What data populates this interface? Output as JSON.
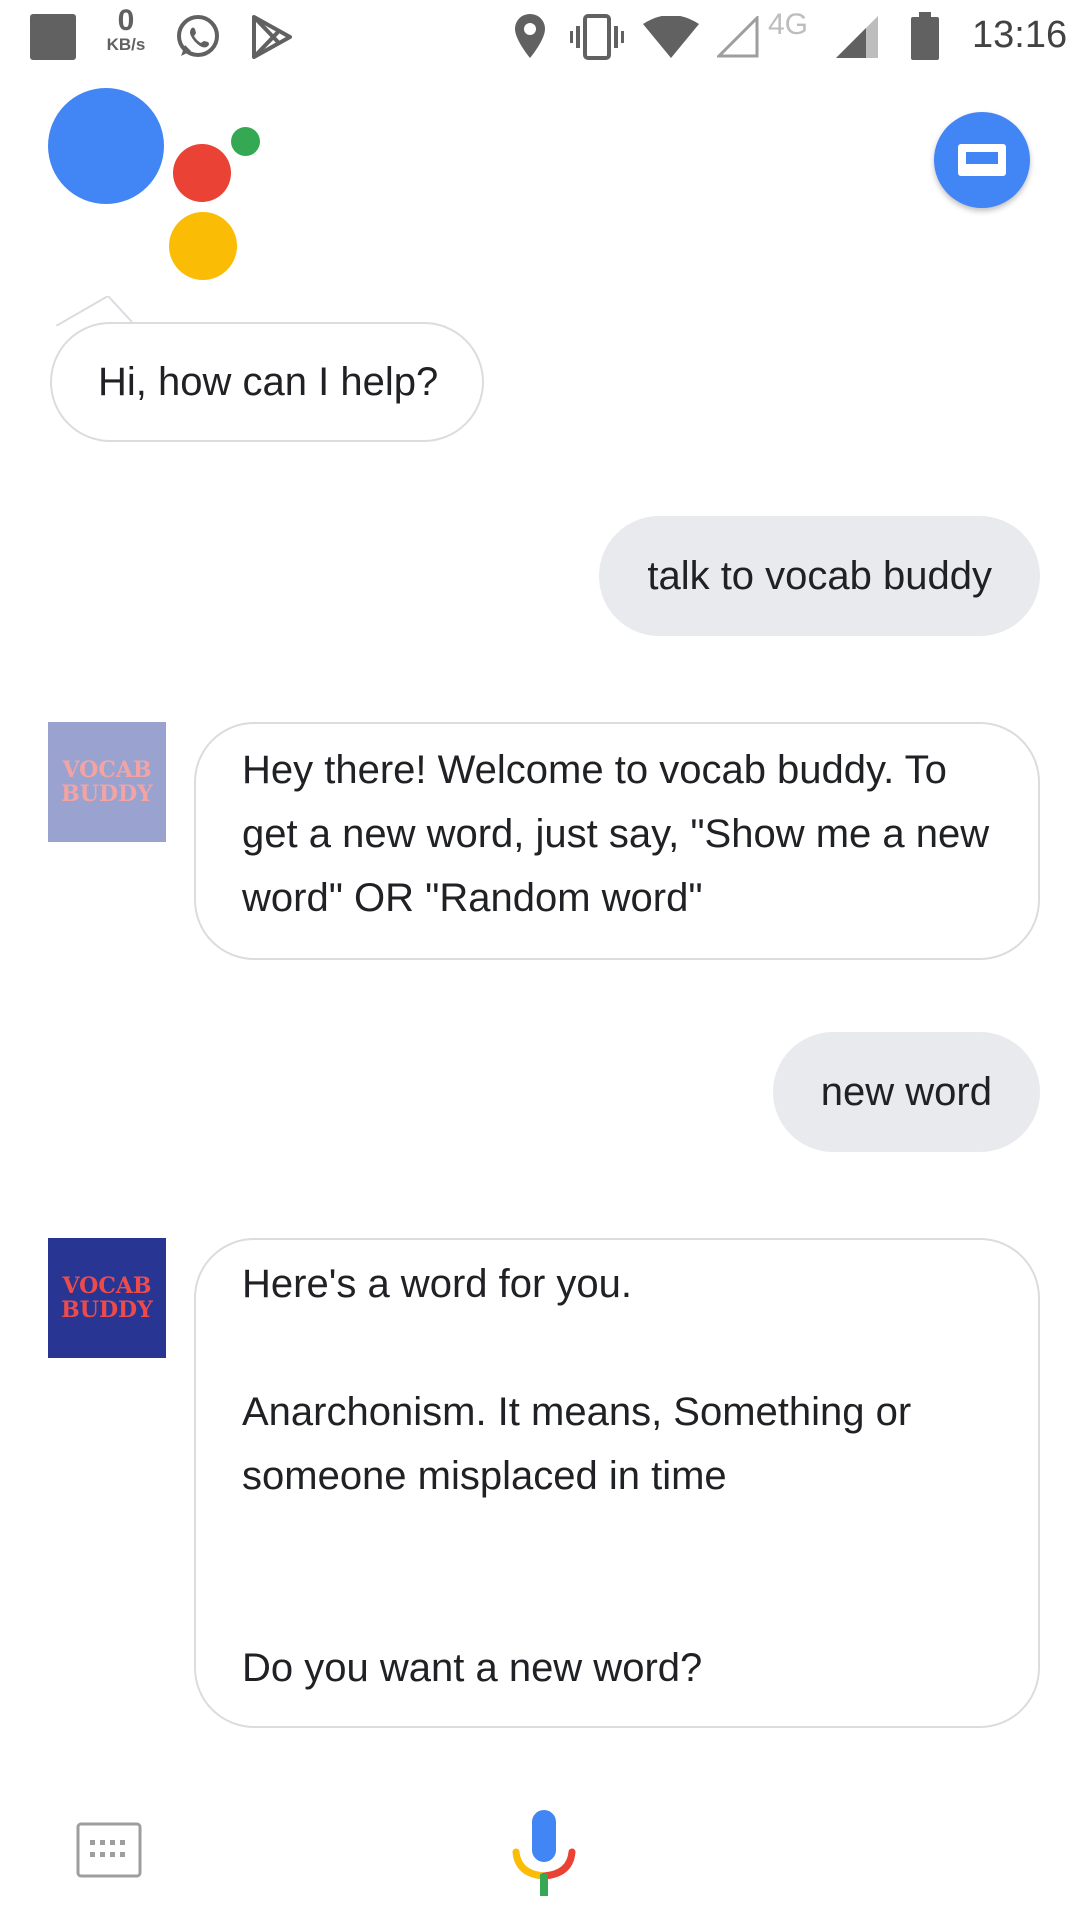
{
  "status_bar": {
    "net_speed_value": "0",
    "net_speed_unit": "KB/s",
    "network_type": "4G",
    "time": "13:16",
    "icons": [
      "notification-square-icon",
      "whatsapp-icon",
      "play-store-icon",
      "location-icon",
      "vibrate-icon",
      "wifi-icon",
      "signal-icon",
      "battery-icon"
    ]
  },
  "assistant": {
    "greeting": "Hi, how can I help?",
    "logo_colors": {
      "blue": "#4285f4",
      "red": "#ea4335",
      "green": "#34a853",
      "yellow": "#fbbc05"
    }
  },
  "conversation": {
    "user_message_1": "talk to vocab buddy",
    "bot_avatar_text_line1": "VOCAB",
    "bot_avatar_text_line2": "BUDDY",
    "bot_message_1": "Hey there! Welcome to vocab buddy. To get a new word, just say, \"Show me a new word\" OR \"Random word\"",
    "user_message_2": "new word",
    "bot_message_2": "Here's a word for you.\n\nAnarchonism. It means, Something or someone misplaced in time\n\n\nDo you want a new word?"
  },
  "bottom_bar": {
    "icons": [
      "keyboard-icon",
      "microphone-icon"
    ]
  }
}
